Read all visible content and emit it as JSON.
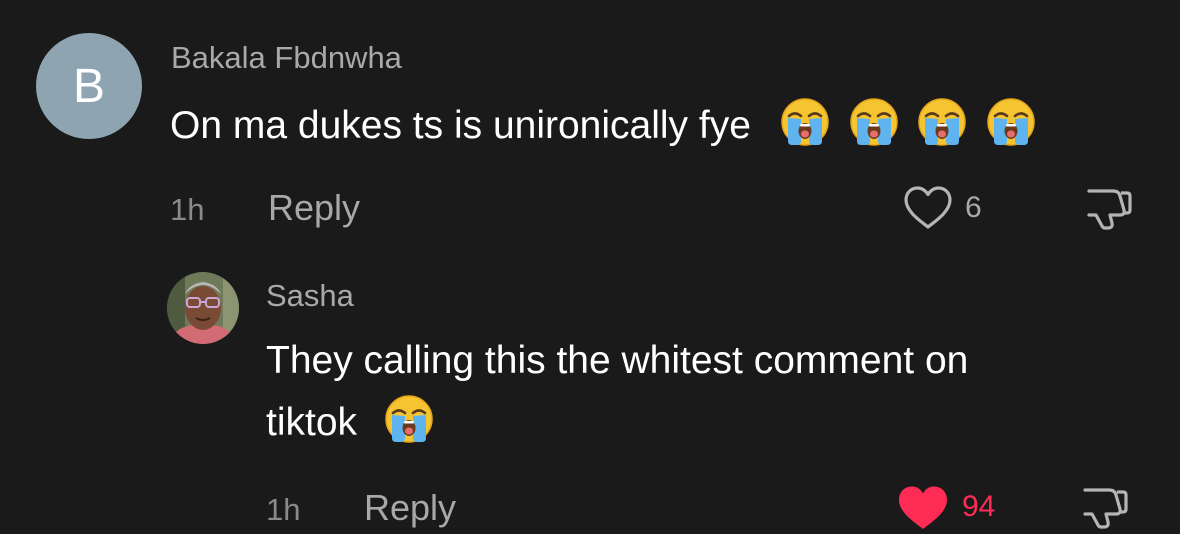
{
  "comments": [
    {
      "avatar_letter": "B",
      "avatar_color": "#8ea4b1",
      "username": "Bakala Fbdnwha",
      "text": "On ma dukes ts is unironically fye",
      "emoji": [
        "loudly-crying-face",
        "loudly-crying-face",
        "loudly-crying-face",
        "loudly-crying-face"
      ],
      "time": "1h",
      "reply_label": "Reply",
      "like_count": "6",
      "liked": false
    }
  ],
  "replies": [
    {
      "username": "Sasha",
      "avatar": "profile-photo",
      "text_line1": "They calling this the whitest comment on",
      "text_line2": "tiktok",
      "emoji": [
        "loudly-crying-face"
      ],
      "time": "1h",
      "reply_label": "Reply",
      "like_count": "94",
      "liked": true
    }
  ],
  "colors": {
    "background": "#1a1a1a",
    "liked_red": "#fe2c55",
    "muted_text": "#a9a9a9"
  }
}
